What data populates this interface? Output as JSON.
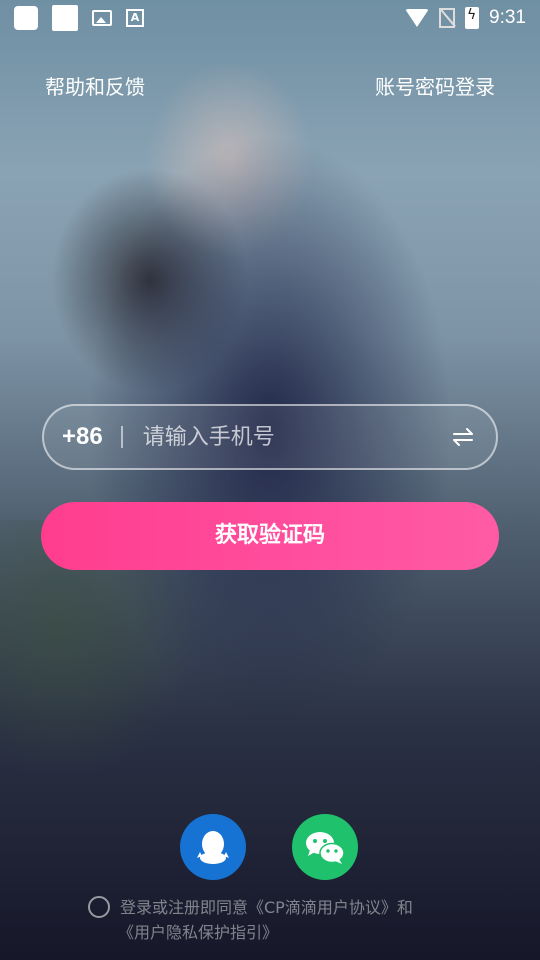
{
  "status_bar": {
    "time": "9:31",
    "icons": [
      "app-notification-icon",
      "app-notification-icon",
      "gallery-icon",
      "font-icon",
      "wifi-icon",
      "no-sim-icon",
      "battery-charging-icon"
    ]
  },
  "header": {
    "help_label": "帮助和反馈",
    "password_login_label": "账号密码登录"
  },
  "phone_login": {
    "country_code": "+86",
    "placeholder": "请输入手机号",
    "value": "",
    "switch_icon": "swap-icon",
    "get_code_label": "获取验证码"
  },
  "social_login": [
    {
      "icon": "qq-icon",
      "color": "#1673d3"
    },
    {
      "icon": "wechat-icon",
      "color": "#1fc16d"
    }
  ],
  "agreement": {
    "text_line1": "登录或注册即同意《CP滴滴用户协议》和",
    "text_line2": "《用户隐私保护指引》"
  },
  "colors": {
    "primary_button": "#ff4f9e",
    "qq": "#1673d3",
    "wechat": "#1fc16d"
  }
}
